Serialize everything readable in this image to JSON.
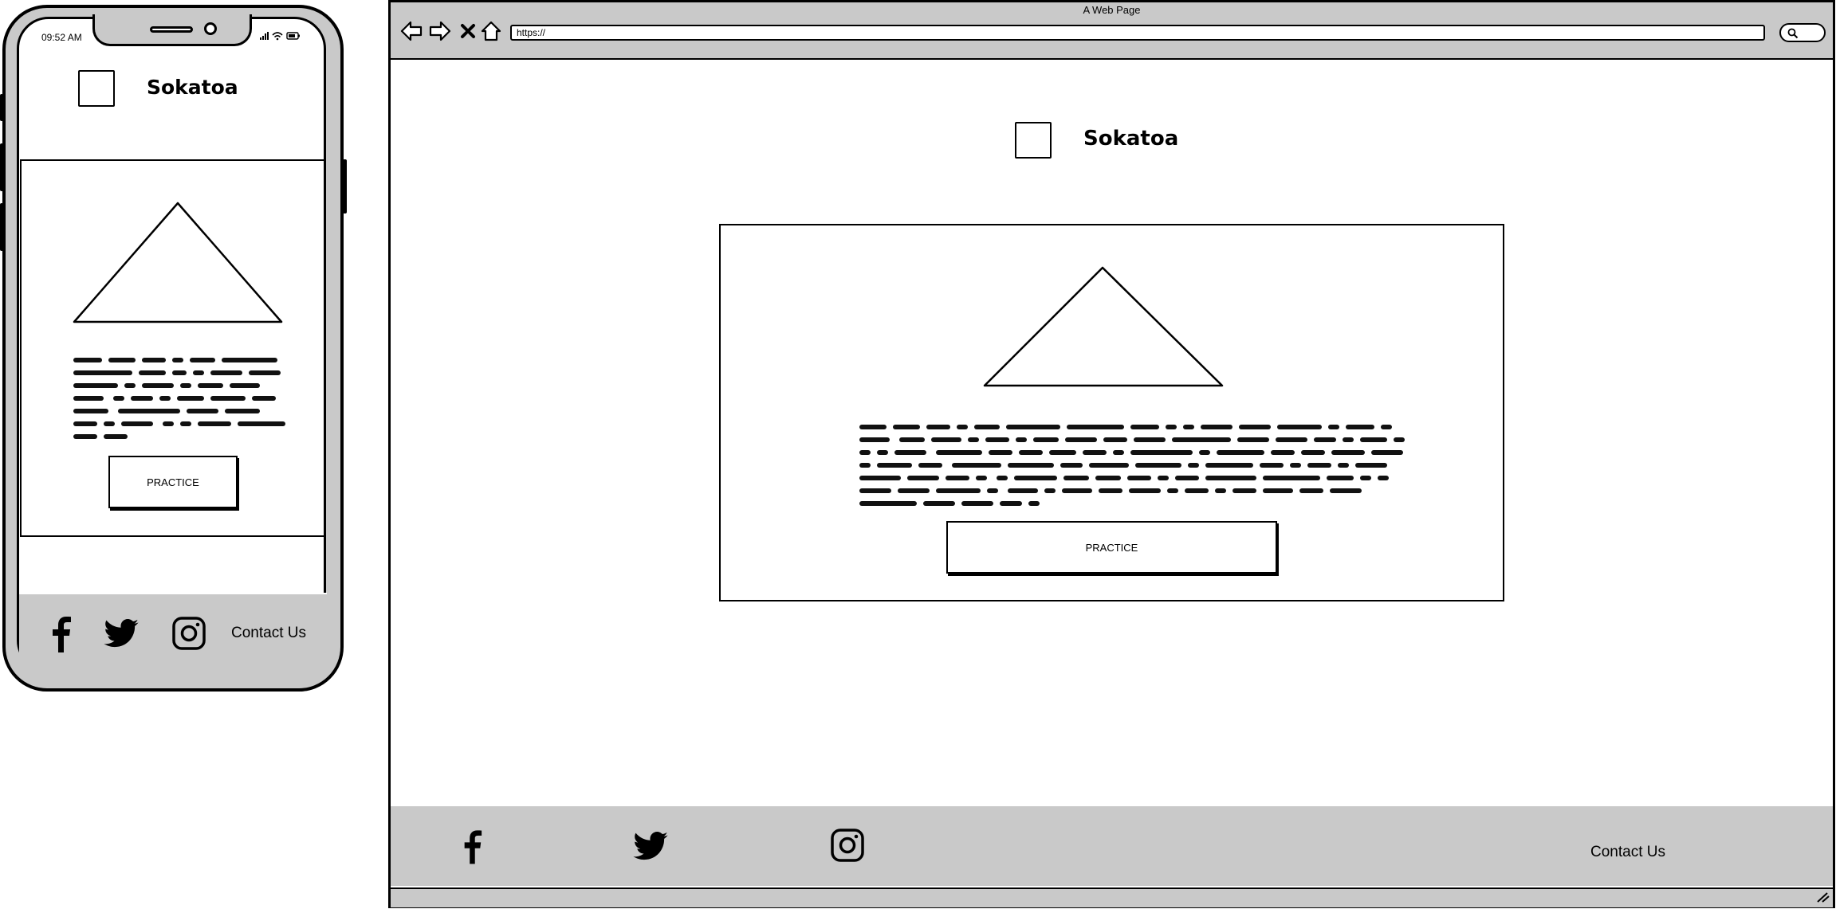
{
  "phone": {
    "status_time": "09:52 AM",
    "brand_name": "Sokatoa",
    "practice_label": "PRACTICE",
    "footer": {
      "icons": [
        "facebook-icon",
        "twitter-icon",
        "instagram-icon"
      ],
      "contact_label": "Contact Us"
    }
  },
  "browser": {
    "window_title": "A Web Page",
    "url": "https://",
    "nav_icons": [
      "back-arrow-icon",
      "forward-arrow-icon",
      "stop-x-icon",
      "home-icon",
      "search-icon"
    ],
    "brand_name": "Sokatoa",
    "practice_label": "PRACTICE",
    "footer": {
      "icons": [
        "facebook-icon",
        "twitter-icon",
        "instagram-icon"
      ],
      "contact_label": "Contact Us"
    }
  },
  "colors": {
    "frame_gray": "#c9c9c9",
    "ink": "#000000",
    "paper": "#ffffff"
  }
}
